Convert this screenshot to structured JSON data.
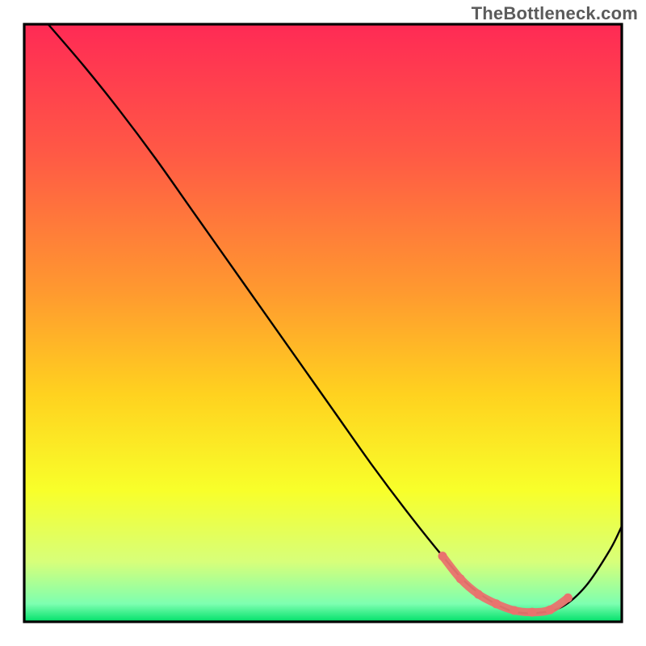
{
  "watermark": "TheBottleneck.com",
  "chart_data": {
    "type": "line",
    "title": "",
    "xlabel": "",
    "ylabel": "",
    "xlim": [
      0,
      100
    ],
    "ylim": [
      0,
      100
    ],
    "grid": false,
    "legend": false,
    "background_gradient_stops": [
      {
        "offset": 0.0,
        "color": "#ff2a55"
      },
      {
        "offset": 0.22,
        "color": "#ff5a45"
      },
      {
        "offset": 0.45,
        "color": "#ff9a2f"
      },
      {
        "offset": 0.62,
        "color": "#ffd21f"
      },
      {
        "offset": 0.78,
        "color": "#f8ff2a"
      },
      {
        "offset": 0.9,
        "color": "#d7ff7a"
      },
      {
        "offset": 0.97,
        "color": "#7dffb0"
      },
      {
        "offset": 1.0,
        "color": "#00e06a"
      }
    ],
    "series": [
      {
        "name": "bottleneck-curve",
        "color": "#000000",
        "stroke_width": 2.4,
        "x": [
          4,
          10,
          16,
          22,
          28,
          34,
          40,
          46,
          52,
          58,
          64,
          70,
          74,
          78,
          82,
          86,
          90,
          94,
          98,
          100
        ],
        "values": [
          100,
          93,
          85.5,
          77.5,
          69,
          60.5,
          52,
          43.5,
          35,
          26.5,
          18.5,
          11,
          6.5,
          3.5,
          1.7,
          1.5,
          2.5,
          6,
          12,
          16
        ]
      },
      {
        "name": "highlight-band",
        "color": "#e9736e",
        "stroke_width": 10,
        "x": [
          70,
          73,
          76,
          79,
          82,
          85,
          88,
          91
        ],
        "values": [
          11,
          7.2,
          4.6,
          3.0,
          1.9,
          1.6,
          2.0,
          4.0
        ]
      }
    ]
  }
}
